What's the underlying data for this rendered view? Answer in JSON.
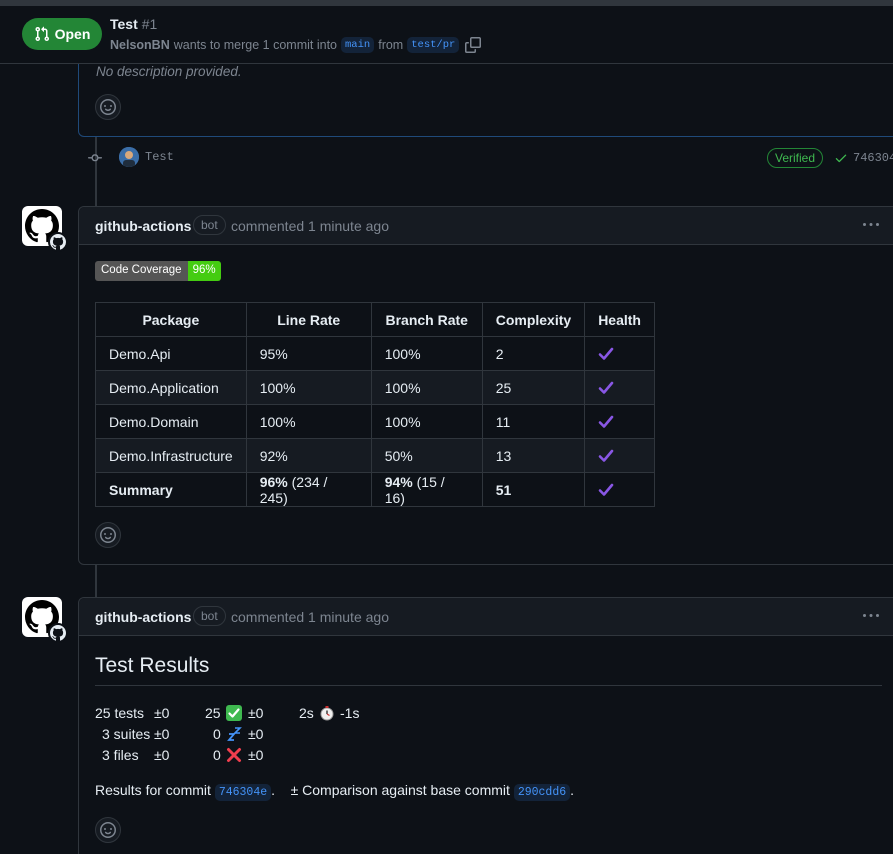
{
  "header": {
    "status": "Open",
    "title": "Test",
    "number": "#1",
    "author": "NelsonBN",
    "meta_text": "wants to merge 1 commit into",
    "base_branch": "main",
    "from_text": "from",
    "head_branch": "test/pr"
  },
  "description": {
    "text": "No description provided."
  },
  "commit": {
    "message": "Test",
    "verified": "Verified",
    "sha": "746304"
  },
  "comments": [
    {
      "author": "github-actions",
      "badge": "bot",
      "time": "commented 1 minute ago",
      "coverage_badge": {
        "label": "Code Coverage",
        "value": "96%"
      },
      "table": {
        "headers": [
          "Package",
          "Line Rate",
          "Branch Rate",
          "Complexity",
          "Health"
        ],
        "rows": [
          [
            "Demo.Api",
            "95%",
            "100%",
            "2"
          ],
          [
            "Demo.Application",
            "100%",
            "100%",
            "25"
          ],
          [
            "Demo.Domain",
            "100%",
            "100%",
            "11"
          ],
          [
            "Demo.Infrastructure",
            "92%",
            "50%",
            "13"
          ]
        ],
        "summary": {
          "label": "Summary",
          "line_bold": "96%",
          "line_rest": " (234 / 245)",
          "branch_bold": "94%",
          "branch_rest": " (15 / 16)",
          "complexity": "51"
        }
      }
    },
    {
      "author": "github-actions",
      "badge": "bot",
      "time": "commented 1 minute ago",
      "heading": "Test Results",
      "rows": [
        {
          "a": "25 tests",
          "b": "±0",
          "c": "25",
          "c_icon": "check-mark-icon",
          "d": "±0",
          "e": "2s",
          "e_icon": "stopwatch-icon",
          "f": "-1s"
        },
        {
          "a": "3 suites",
          "b": "±0",
          "c": "0",
          "c_icon": "zzz-icon",
          "d": "±0"
        },
        {
          "a": "3 files",
          "b": "±0",
          "c": "0",
          "c_icon": "cross-mark-icon",
          "d": "±0"
        }
      ],
      "footer": {
        "prefix": "Results for commit",
        "commit": "746304e",
        "dot": ".",
        "comparison": "± Comparison against base commit",
        "base_commit": "290cdd6",
        "end": "."
      }
    }
  ],
  "colors": {
    "open_green": "#238636",
    "link_blue": "#4493f8",
    "health_purple": "#8957e5",
    "coverage_green": "#44cc11"
  }
}
